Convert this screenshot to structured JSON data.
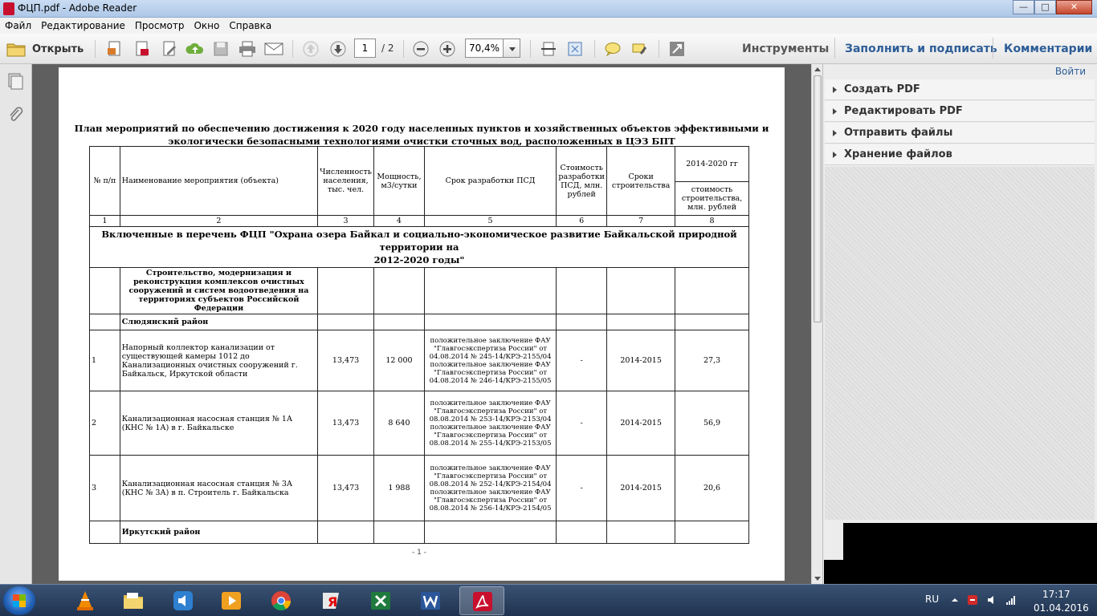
{
  "window": {
    "title": "ФЦП.pdf - Adobe Reader",
    "controls": [
      "—",
      "□",
      "✕"
    ]
  },
  "menu": [
    "Файл",
    "Редактирование",
    "Просмотр",
    "Окно",
    "Справка"
  ],
  "toolbar": {
    "open_label": "Открыть",
    "page_current": "1",
    "page_total": "/ 2",
    "zoom": "70,4%",
    "tabs": [
      "Инструменты",
      "Заполнить и подписать",
      "Комментарии"
    ]
  },
  "right_pane": {
    "login": "Войти",
    "sections": [
      "Создать PDF",
      "Редактировать PDF",
      "Отправить файлы",
      "Хранение файлов"
    ]
  },
  "document": {
    "title_line1": "План  мероприятий по обеспечению достижения к 2020 году  населенных пунктов и хозяйственных объектов эффективными и",
    "title_line2": "экологически безопасными технологиями очистки сточных вод, расположенных в ЦЭЗ БПТ",
    "headers": {
      "num": "№ п/п",
      "name": "Наименование мероприятия (объекта)",
      "population": "Численность населения, тыс. чел.",
      "capacity": "Мощность, м3/сутки",
      "psd_term": "Срок разработки ПСД",
      "psd_cost": "Стоимость разработки ПСД, млн. рублей",
      "construction_term": "Сроки строительства",
      "period": "2014-2020 гг",
      "construction_cost": "стоимость строительства, млн. рублей"
    },
    "col_numbers": [
      "1",
      "2",
      "3",
      "4",
      "5",
      "6",
      "7",
      "8"
    ],
    "section_title_line1": "Включенные в перечень ФЦП \"Охрана озера Байкал и социально-экономическое развитие Байкальской природной территории на",
    "section_title_line2": "2012-2020 годы\"",
    "subsection": "Строительство, модернизация и реконструкция комплексов очистных сооружений и систем водоотведения на территориях субъектов Российской Федерации",
    "district1": "Слюдянский район",
    "rows": [
      {
        "num": "1",
        "name": "Напорный коллектор канализации от существующей камеры 1012 до Канализационных очистных сооружений г. Байкальск, Иркутской области",
        "population": "13,473",
        "capacity": "12 000",
        "psd_a": "положительное заключение ФАУ \"Главгосэкспертиза России\" от 04.08.2014  № 245-14/КРЭ-2155/04",
        "psd_b": "положительное заключение ФАУ \"Главгосэкспертиза России\" от 04.08.2014 № 246-14/КРЭ-2155/05",
        "psd_cost": "-",
        "term": "2014-2015",
        "cost": "27,3"
      },
      {
        "num": "2",
        "name": "Канализационная насосная станция № 1А (КНС № 1А) в г. Байкальске",
        "population": "13,473",
        "capacity": "8 640",
        "psd_a": "положительное заключение ФАУ \"Главгосэкспертиза России\" от 08.08.2014  № 253-14/КРЭ-2153/04",
        "psd_b": "положительное заключение ФАУ \"Главгосэкспертиза России\" от 08.08.2014 № 255-14/КРЭ-2153/05",
        "psd_cost": "-",
        "term": "2014-2015",
        "cost": "56,9"
      },
      {
        "num": "3",
        "name": "Канализационная насосная станция № 3А (КНС № 3А) в п. Строитель г. Байкальска",
        "population": "13,473",
        "capacity": "1 988",
        "psd_a": "положительное заключение ФАУ \"Главгосэкспертиза России\" от 08.08.2014  № 252-14/КРЭ-2154/04",
        "psd_b": "положительное заключение ФАУ \"Главгосэкспертиза России\" от 08.08.2014 № 256-14/КРЭ-2154/05",
        "psd_cost": "-",
        "term": "2014-2015",
        "cost": "20,6"
      }
    ],
    "district2": "Иркутский район",
    "page_footer": "- 1 -"
  },
  "taskbar": {
    "lang": "RU",
    "time": "17:17",
    "date": "01.04.2016"
  }
}
